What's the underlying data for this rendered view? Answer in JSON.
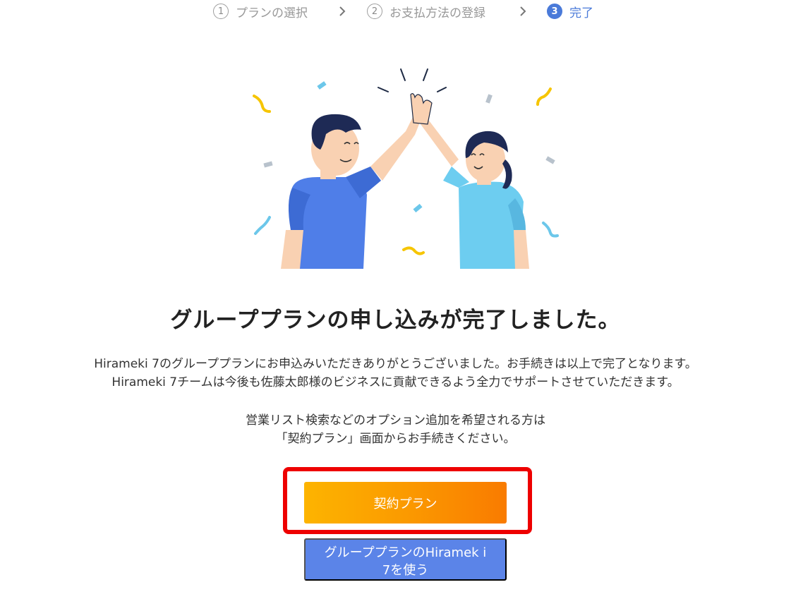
{
  "stepper": {
    "steps": [
      {
        "number": "1",
        "label": "プランの選択",
        "state": "inactive"
      },
      {
        "number": "2",
        "label": "お支払方法の登録",
        "state": "inactive"
      },
      {
        "number": "3",
        "label": "完了",
        "state": "active"
      }
    ],
    "separator_icon": "chevron-right-icon"
  },
  "illustration": {
    "subject": "high-five-illustration"
  },
  "main": {
    "headline": "グループプランの申し込みが完了しました。",
    "description_lines": [
      "Hirameki 7のグループプランにお申込みいただきありがとうございました。お手続きは以上で完了となります。",
      "Hirameki 7チームは今後も佐藤太郎様のビジネスに貢献できるよう全力でサポートさせていただきます。"
    ],
    "option_lines": [
      "営業リスト検索などのオプション追加を希望される方は",
      "「契約プラン」画面からお手続きください。"
    ]
  },
  "buttons": {
    "contract_plan": "契約プラン",
    "use_group_plan": "グループプランのHiramek i 7を使う"
  },
  "colors": {
    "accent": "#4a7ad9",
    "orange_start": "#fdb400",
    "orange_end": "#f97b00",
    "blue_button": "#5b84e8",
    "highlight_border": "#ee0000"
  }
}
